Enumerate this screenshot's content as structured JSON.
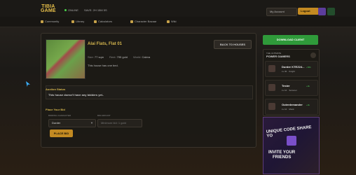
{
  "topbar": {
    "logo_line1": "TIBIA",
    "logo_line2": "GAME",
    "online": "ONLINE",
    "save": "SAVE: 2H 15M 5S",
    "my_account": "My Account",
    "logout": "Logout"
  },
  "nav": [
    {
      "label": "Community"
    },
    {
      "label": "Library"
    },
    {
      "label": "Calculators"
    },
    {
      "label": "Character Bazaar"
    },
    {
      "label": "Wiki"
    }
  ],
  "house": {
    "title": "Alai Flats, Flat 01",
    "size_label": "Size:",
    "size_value": "77 sqm",
    "rent_label": "Rent:",
    "rent_value": "795 gold",
    "world_label": "World:",
    "world_value": "Calera",
    "beds_note": "This house has one bed.",
    "back_button": "BACK TO HOUSES"
  },
  "auction": {
    "title": "Auction Status",
    "text": "This house doesn't have any bidders yet.."
  },
  "bid": {
    "title": "Place Your Bid",
    "bidding_character_label": "BIDDING CHARACTER",
    "bidding_character_value": "Durder",
    "bid_amount_label": "BID AMOUNT",
    "bid_amount_placeholder": "Minimum bid: 1 gold",
    "place_bid_button": "PLACE BID"
  },
  "sidebar": {
    "download": "DOWNLOAD CLIENT",
    "gamers_sub": "THE ULTIMATE",
    "gamers_title": "POWER GAMERS",
    "gamers": [
      {
        "name": "Durder KTEZ24...",
        "level": "Lv 30",
        "voc": "Knight",
        "stat": "+58k"
      },
      {
        "name": "Tester",
        "level": "Lv 10",
        "voc": "Sorcerer",
        "stat": "+0k"
      },
      {
        "name": "Outerdemander",
        "level": "Lv 10",
        "voc": "Monk",
        "stat": "+0k"
      }
    ],
    "promo_top": "UNIQUE CODE SHARE YO",
    "promo_bottom_1": "INVITE YOUR",
    "promo_bottom_2": "FRIENDS"
  },
  "colors": {
    "accent_gold": "#c38a22",
    "title_gold": "#d5b64e",
    "download_green": "#2f9a3a"
  }
}
